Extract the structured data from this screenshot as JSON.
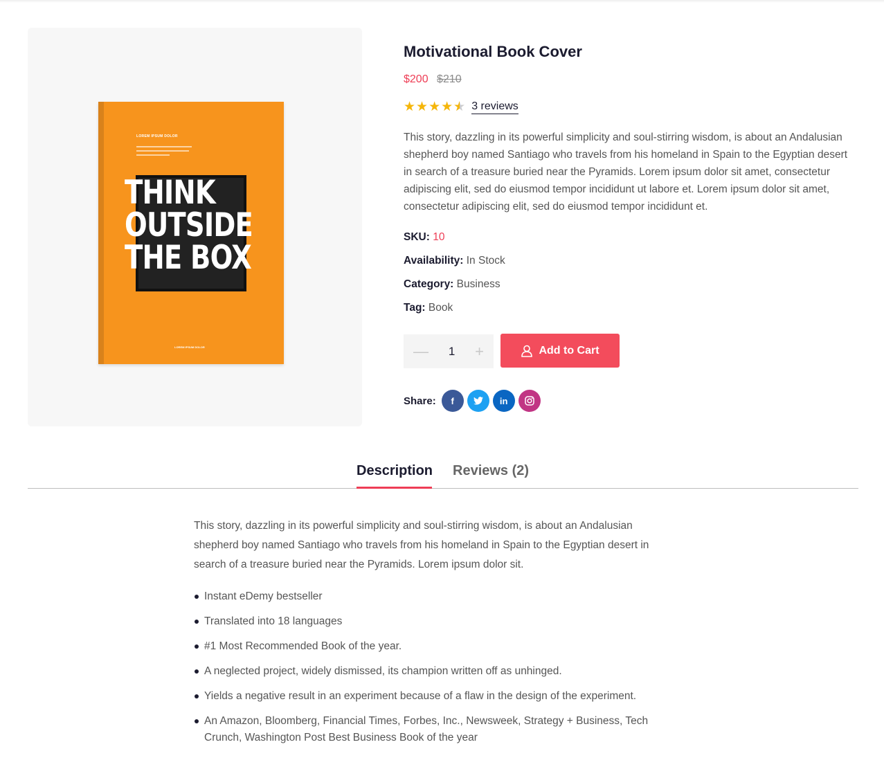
{
  "product": {
    "title": "Motivational Book Cover",
    "price_current": "$200",
    "price_old": "$210",
    "rating": 4.5,
    "reviews_link": "3 reviews",
    "summary": "This story, dazzling in its powerful simplicity and soul-stirring wisdom, is about an Andalusian shepherd boy named Santiago who travels from his homeland in Spain to the Egyptian desert in search of a treasure buried near the Pyramids. Lorem ipsum dolor sit amet, consectetur adipiscing elit, sed do eiusmod tempor incididunt ut labore et. Lorem ipsum dolor sit amet, consectetur adipiscing elit, sed do eiusmod tempor incididunt et.",
    "meta": {
      "sku_label": "SKU:",
      "sku_value": "10",
      "availability_label": "Availability:",
      "availability_value": "In Stock",
      "category_label": "Category:",
      "category_value": "Business",
      "tag_label": "Tag:",
      "tag_value": "Book"
    },
    "quantity": "1",
    "add_to_cart_label": "Add to Cart",
    "share_label": "Share:",
    "share_icons": [
      {
        "name": "facebook-icon",
        "color": "#3b5998"
      },
      {
        "name": "twitter-icon",
        "color": "#1da1f2"
      },
      {
        "name": "linkedin-icon",
        "color": "#0a66c2"
      },
      {
        "name": "instagram-icon",
        "color": "#c13584"
      }
    ]
  },
  "cover": {
    "top_label": "LOREM IPSUM DOLOR",
    "line1": "THINK",
    "line2": "OUTSIDE",
    "line3": "THE BOX",
    "bottom_label": "LOREM IPSUM DOLOR",
    "color": "#f7941d"
  },
  "tabs": [
    {
      "label": "Description",
      "active": true
    },
    {
      "label": "Reviews (2)",
      "active": false
    }
  ],
  "description": {
    "text": "This story, dazzling in its powerful simplicity and soul-stirring wisdom, is about an Andalusian shepherd boy named Santiago who travels from his homeland in Spain to the Egyptian desert in search of a treasure buried near the Pyramids. Lorem ipsum dolor sit.",
    "bullets": [
      "Instant eDemy bestseller",
      "Translated into 18 languages",
      "#1 Most Recommended Book of the year.",
      "A neglected project, widely dismissed, its champion written off as unhinged.",
      "Yields a negative result in an experiment because of a flaw in the design of the experiment.",
      "An Amazon, Bloomberg, Financial Times, Forbes, Inc., Newsweek, Strategy + Business, Tech Crunch, Washington Post Best Business Book of the year"
    ]
  },
  "colors": {
    "accent": "#ee3d55",
    "button": "#f34c5c",
    "star": "#f5b60a",
    "heading": "#1b1b2f"
  }
}
